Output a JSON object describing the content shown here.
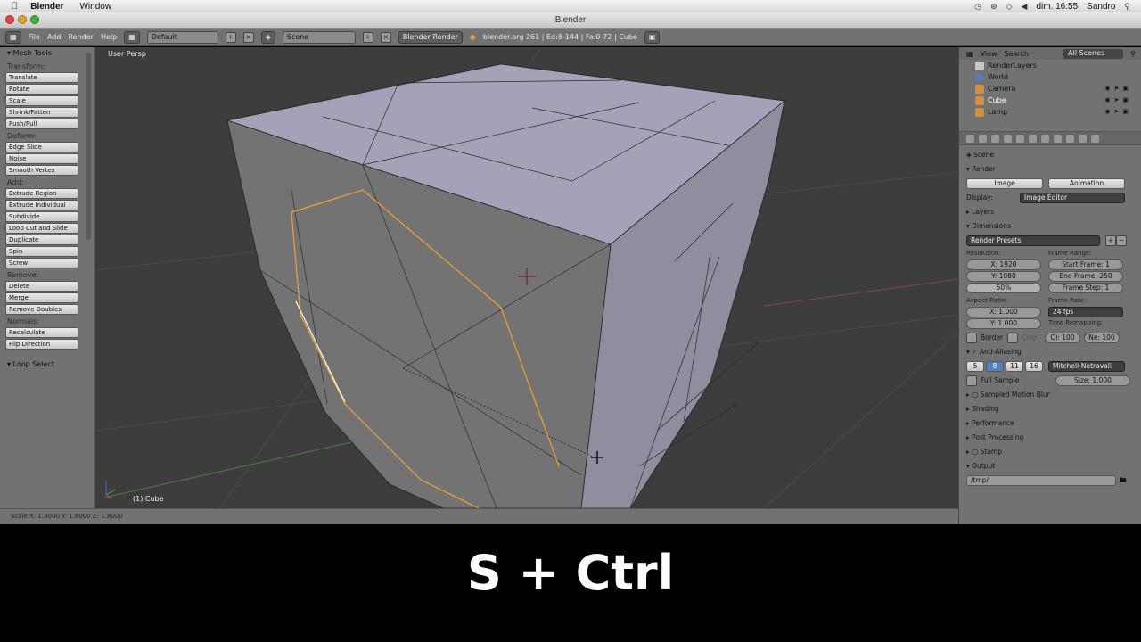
{
  "mac_menubar": {
    "apple_icon": "apple-icon",
    "app_name": "Blender",
    "menu_window": "Window",
    "datetime": "dim. 16:55",
    "user": "Sandro"
  },
  "window": {
    "title": "Blender"
  },
  "info_header": {
    "menus": [
      "File",
      "Add",
      "Render",
      "Help"
    ],
    "screen_layout": "Default",
    "scene": "Scene",
    "engine": "Blender Render",
    "stats": "blender.org 261 | Ed:8-144 | Fa:0-72 | Cube"
  },
  "toolshelf": {
    "title": "Mesh Tools",
    "sections": [
      {
        "label": "Transform:",
        "buttons": [
          "Translate",
          "Rotate",
          "Scale",
          "Shrink/Fatten",
          "Push/Pull"
        ]
      },
      {
        "label": "Deform:",
        "buttons": [
          "Edge Slide",
          "Noise",
          "Smooth Vertex"
        ]
      },
      {
        "label": "Add:",
        "buttons": [
          "Extrude Region",
          "Extrude Individual",
          "Subdivide",
          "Loop Cut and Slide",
          "Duplicate",
          "Spin",
          "Screw"
        ]
      },
      {
        "label": "Remove:",
        "buttons": [
          "Delete",
          "Merge",
          "Remove Doubles"
        ]
      },
      {
        "label": "Normals:",
        "buttons": [
          "Recalculate",
          "Flip Direction"
        ]
      }
    ],
    "loop_select": "Loop Select"
  },
  "viewport": {
    "view_label": "User Persp",
    "object_label": "(1) Cube"
  },
  "statusbar": {
    "text": "Scale X: 1.8000   Y: 1.8000   Z: 1.8000"
  },
  "outliner": {
    "view": "View",
    "search": "Search",
    "scenes": "All Scenes",
    "rows": [
      "RenderLayers",
      "World",
      "Camera",
      "Cube",
      "Lamp"
    ]
  },
  "properties": {
    "scene": "Scene",
    "render_header": "Render",
    "image_btn": "Image",
    "animation_btn": "Animation",
    "display_label": "Display:",
    "display_value": "Image Editor",
    "layers": "Layers",
    "dimensions": "Dimensions",
    "render_presets": "Render Presets",
    "resolution_label": "Resolution:",
    "res_x": "X: 1920",
    "res_y": "Y: 1080",
    "res_pct": "50%",
    "frame_range_label": "Frame Range:",
    "start_frame": "Start Frame: 1",
    "end_frame": "End Frame: 250",
    "frame_step": "Frame Step: 1",
    "aspect_label": "Aspect Ratio:",
    "aspect_x": "X: 1.000",
    "aspect_y": "Y: 1.000",
    "frame_rate_label": "Frame Rate:",
    "fps": "24 fps",
    "time_remap_label": "Time Remapping:",
    "old": "Ol: 100",
    "new": "Ne: 100",
    "border": "Border",
    "crop": "Crop",
    "anti_aliasing": "Anti-Aliasing",
    "aa_samples": [
      "5",
      "8",
      "11",
      "16"
    ],
    "aa_filter": "Mitchell-Netravali",
    "full_sample": "Full Sample",
    "size": "Size: 1.000",
    "sampled_motion_blur": "Sampled Motion Blur",
    "shading": "Shading",
    "performance": "Performance",
    "post_processing": "Post Processing",
    "stamp": "Stamp",
    "output": "Output",
    "output_path": "/tmp/"
  },
  "caption": {
    "text": "S + Ctrl"
  },
  "colors": {
    "ui_gray": "#727272",
    "viewport_bg": "#3d3d3d",
    "face_top": "#a3a2b8",
    "face_side": "#8f8e9f",
    "face_front": "#6f6f6f",
    "selection_orange": "#f0a030",
    "aa_selected": "#5680c2"
  }
}
